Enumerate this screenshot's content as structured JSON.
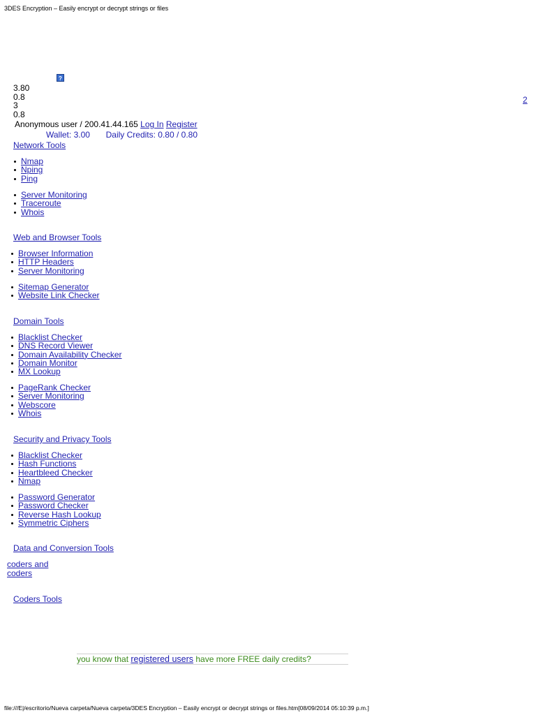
{
  "header": {
    "print_title": "3DES Encryption – Easily encrypt or decrypt strings or files"
  },
  "footer": {
    "print_path": "file:///E|/escritorio/Nueva carpeta/Nueva carpeta/3DES Encryption – Easily encrypt or decrypt strings or files.htm[08/09/2014 05:10:39 p.m.]"
  },
  "help": {
    "icon_glyph": "?",
    "number": "2"
  },
  "stats": [
    "3.80",
    "0.8",
    "3",
    "0.8"
  ],
  "user": {
    "label": "Anonymous user /",
    "ip": "200.41.44.165",
    "login": "Log In",
    "register": "Register",
    "wallet": "Wallet: 3.00",
    "daily_credits": "Daily Credits: 0.80 / 0.80"
  },
  "nav": {
    "network": {
      "title": "Network Tools",
      "group1": [
        "Nmap",
        "Nping",
        "Ping"
      ],
      "group2": [
        "Server Monitoring",
        "Traceroute",
        "Whois"
      ]
    },
    "web": {
      "title": "Web and Browser Tools",
      "group1": [
        "Browser Information",
        "HTTP Headers",
        "Server Monitoring"
      ],
      "group2": [
        "Sitemap Generator",
        "Website Link Checker"
      ]
    },
    "domain": {
      "title": "Domain Tools",
      "group1": [
        "Blacklist Checker",
        "DNS Record Viewer",
        "Domain Availability Checker",
        "Domain Monitor",
        "MX Lookup"
      ],
      "group2": [
        "PageRank Checker",
        "Server Monitoring",
        "Webscore",
        "Whois"
      ]
    },
    "security": {
      "title": "Security and Privacy Tools",
      "group1": [
        "Blacklist Checker",
        "Hash Functions",
        "Heartbleed Checker",
        "Nmap"
      ],
      "group2": [
        "Password Generator",
        "Password Checker",
        "Reverse Hash Lookup",
        "Symmetric Ciphers"
      ]
    },
    "data": {
      "title": "Data and Conversion Tools",
      "cut_line1": "coders and",
      "cut_line2": "coders"
    },
    "coders": {
      "title": "Coders Tools"
    }
  },
  "notice": {
    "prefix": "you know that",
    "link": "registered users",
    "suffix": "have more FREE daily credits?"
  },
  "colors": {
    "link": "#1f1fb0",
    "notice_text": "#3a8a1a"
  }
}
